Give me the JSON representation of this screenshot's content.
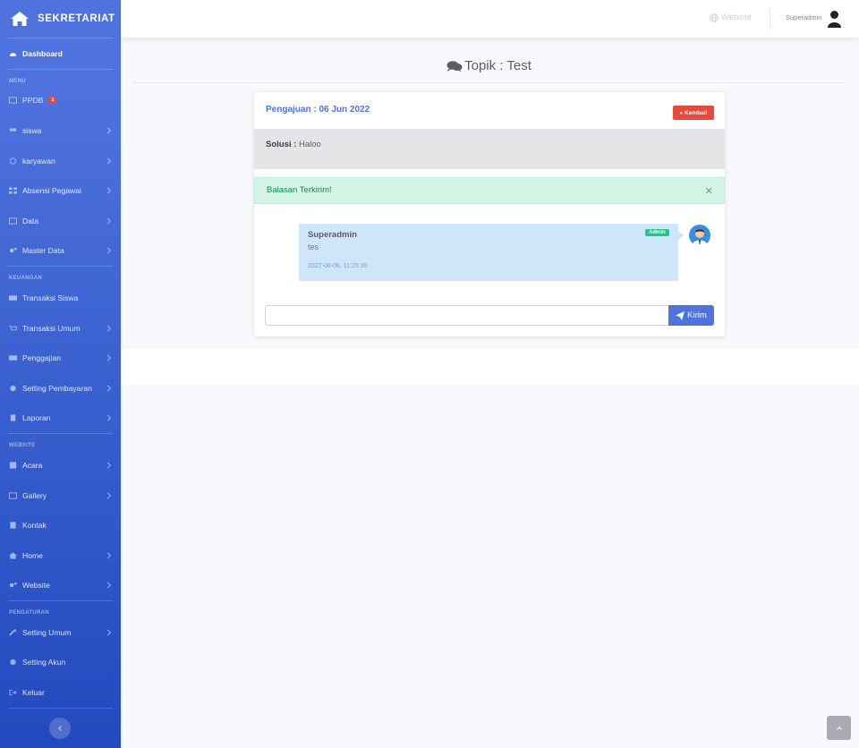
{
  "brand": {
    "title": "SEKRETARIAT"
  },
  "sidebar": {
    "dashboard": "Dashboard",
    "headings": {
      "menu": "MENU",
      "keuangan": "KEUANGAN",
      "website": "WEBSITE",
      "pengaturan": "PENGATURAN"
    },
    "items": {
      "ppdb": "PPDB",
      "ppdb_badge": "1",
      "siswa": "siswa",
      "karyawan": "karyawan",
      "absensi": "Absensi Pegawai",
      "data": "Data",
      "master": "Master Data",
      "transaksi_siswa": "Transaksi Siswa",
      "transaksi_umum": "Transaksi Umum",
      "penggajian": "Penggajian",
      "setting_pembayaran": "Setting Pembayaran",
      "laporan": "Laporan",
      "acara": "Acara",
      "gallery": "Gallery",
      "kontak": "Kontak",
      "home": "Home",
      "website": "Website",
      "setting_umum": "Setting Umum",
      "setting_akun": "Setting Akun",
      "keluar": "Keluar"
    }
  },
  "topbar": {
    "website": "Website",
    "user": "Superadmin"
  },
  "page": {
    "title": "Topik : Test"
  },
  "card": {
    "pengajuan": "Pengajuan : 06 Jun 2022",
    "back_label": "Kembali",
    "solusi_label": "Solusi :",
    "solusi_text": "Haloo",
    "alert": "Balasan Terkirim!",
    "message": {
      "name": "Superadmin",
      "badge": "Admin",
      "text": "tes",
      "time": "2022-06-06, 11:25:39"
    },
    "reply_placeholder": "",
    "send_label": "Kirim"
  },
  "colors": {
    "primary": "#4e73df",
    "danger": "#e74a3b",
    "success": "#1cc88a"
  }
}
